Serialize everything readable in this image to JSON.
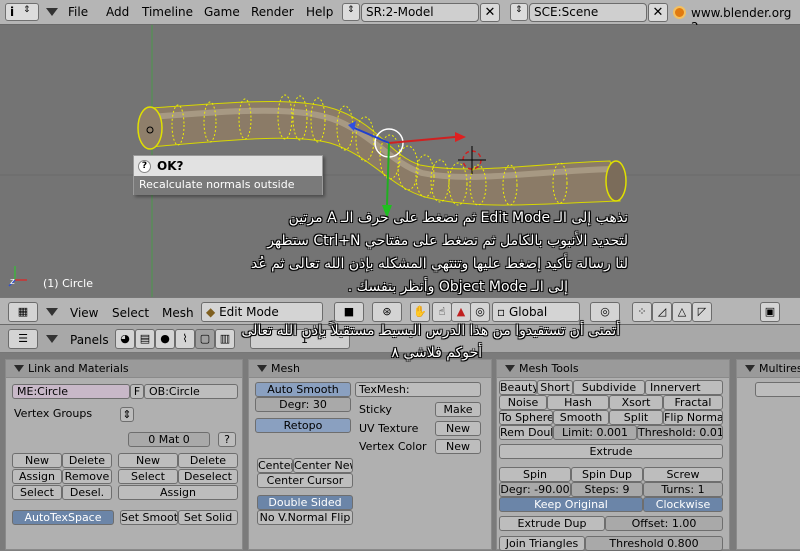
{
  "topbar": {
    "menu": [
      "File",
      "Add",
      "Timeline",
      "Game",
      "Render",
      "Help"
    ],
    "screen_field": "SR:2-Model",
    "scene_field": "SCE:Scene",
    "website": "www.blender.org 2"
  },
  "viewport": {
    "object_label": "(1) Circle",
    "popup": {
      "title": "OK?",
      "message": "Recalculate normals outside"
    },
    "caption_lines": [
      "نذهب إلى الـ Edit Mode ثم نضغط على حرف الـ A مرتين",
      "لتحديد الأنبوب بالكامل ثم نضغط على مفتاحي Ctrl+N ستظهر",
      "لنا رسالة تأكيد إضغط عليها وتنتهي المشكله بإذن الله تعالى ثم عُد",
      "إلى الـ Object Mode وأنظر بنفسك ."
    ],
    "caption_lines_2": [
      "أتمنى أن تستفيدوا من هذا الدرس البسيط مستقبلاً بإذن الله تعالى",
      "أخوكم فلاشي ٨"
    ]
  },
  "view_header": {
    "menu": [
      "View",
      "Select",
      "Mesh"
    ],
    "mode": "Edit Mode",
    "orientation": "Global"
  },
  "buttons_header": {
    "panels_label": "Panels",
    "frame": "1"
  },
  "link_materials": {
    "title": "Link and Materials",
    "mesh_name": "ME:Circle",
    "f_label": "F",
    "object_name": "OB:Circle",
    "vertex_groups": "Vertex Groups",
    "mat_field": "0 Mat 0",
    "q": "?",
    "vg_buttons": [
      "New",
      "Delete",
      "Assign",
      "Remove",
      "Select",
      "Desel."
    ],
    "mat_buttons": [
      "New",
      "Delete",
      "Select",
      "Deselect",
      "Assign"
    ],
    "autotex": "AutoTexSpace",
    "set_smooth": "Set Smooth",
    "set_solid": "Set Solid"
  },
  "mesh_panel": {
    "title": "Mesh",
    "auto_smooth": "Auto Smooth",
    "degr": "Degr: 30",
    "retopo": "Retopo",
    "texmesh": "TexMesh:",
    "sticky": "Sticky",
    "make": "Make",
    "uv_texture": "UV Texture",
    "vertex_color": "Vertex Color",
    "new": "New",
    "center": "Center",
    "center_new": "Center New",
    "center_cursor": "Center Cursor",
    "double_sided": "Double Sided",
    "no_vnormal_flip": "No V.Normal Flip"
  },
  "mesh_tools": {
    "title": "Mesh Tools",
    "row1": [
      "Beauty",
      "Short",
      "Subdivide",
      "Innervert"
    ],
    "row2": [
      "Noise",
      "Hash",
      "Xsort",
      "Fractal"
    ],
    "row3": [
      "To Sphere",
      "Smooth",
      "Split",
      "Flip Normal"
    ],
    "rem_doubl": "Rem Doubl",
    "limit": "Limit: 0.001",
    "threshold": "Threshold: 0.010",
    "extrude": "Extrude",
    "spin": "Spin",
    "spin_dup": "Spin Dup",
    "screw": "Screw",
    "degr": "Degr: -90.00",
    "steps": "Steps: 9",
    "turns": "Turns: 1",
    "keep_original": "Keep Original",
    "clockwise": "Clockwise",
    "extrude_dup": "Extrude Dup",
    "offset": "Offset: 1.00",
    "join_triangles": "Join Triangles",
    "threshold2": "Threshold 0.800"
  },
  "multires": {
    "title": "Multires"
  }
}
